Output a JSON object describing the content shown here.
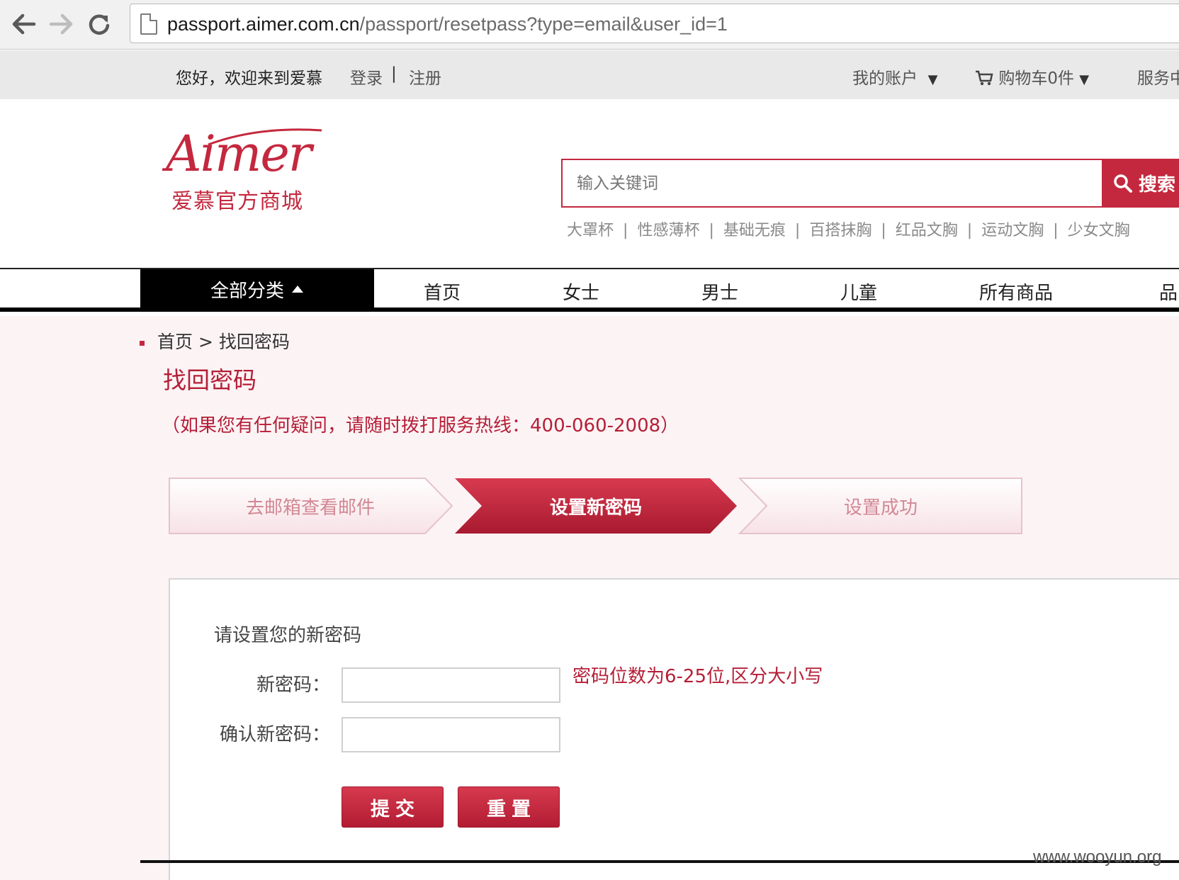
{
  "browser": {
    "url_host": "passport.aimer.com.cn",
    "url_path": "/passport/resetpass?type=email&user_id=1"
  },
  "topbar": {
    "welcome": "您好，欢迎来到爱慕",
    "login": "登录",
    "separator": "|",
    "register": "注册",
    "my_account": "我的账户",
    "cart": "购物车0件",
    "service": "服务中"
  },
  "logo": {
    "wordmark": "Aimer",
    "subtitle": "爱慕官方商城"
  },
  "search": {
    "placeholder": "输入关键词",
    "button": "搜索",
    "hot_words": [
      "大罩杯",
      "性感薄杯",
      "基础无痕",
      "百搭抹胸",
      "红品文胸",
      "运动文胸",
      "少女文胸"
    ]
  },
  "nav": {
    "all_categories": "全部分类",
    "items": [
      "首页",
      "女士",
      "男士",
      "儿童",
      "所有商品",
      "品"
    ]
  },
  "breadcrumb": {
    "home": "首页",
    "separator": ">",
    "current": "找回密码"
  },
  "page": {
    "title": "找回密码",
    "hotline": "（如果您有任何疑问，请随时拨打服务热线：400-060-2008）"
  },
  "steps": [
    {
      "label": "去邮箱查看邮件",
      "active": false
    },
    {
      "label": "设置新密码",
      "active": true
    },
    {
      "label": "设置成功",
      "active": false
    }
  ],
  "form": {
    "heading": "请设置您的新密码",
    "new_password_label": "新密码：",
    "confirm_password_label": "确认新密码：",
    "new_password_value": "",
    "confirm_password_value": "",
    "hint": "密码位数为6-25位,区分大小写",
    "submit": "提交",
    "reset": "重置"
  },
  "watermark": "www.wooyun.org",
  "colors": {
    "brand": "#c4283e",
    "step_active": "#c4283e",
    "content_bg": "#fcf3f5"
  }
}
